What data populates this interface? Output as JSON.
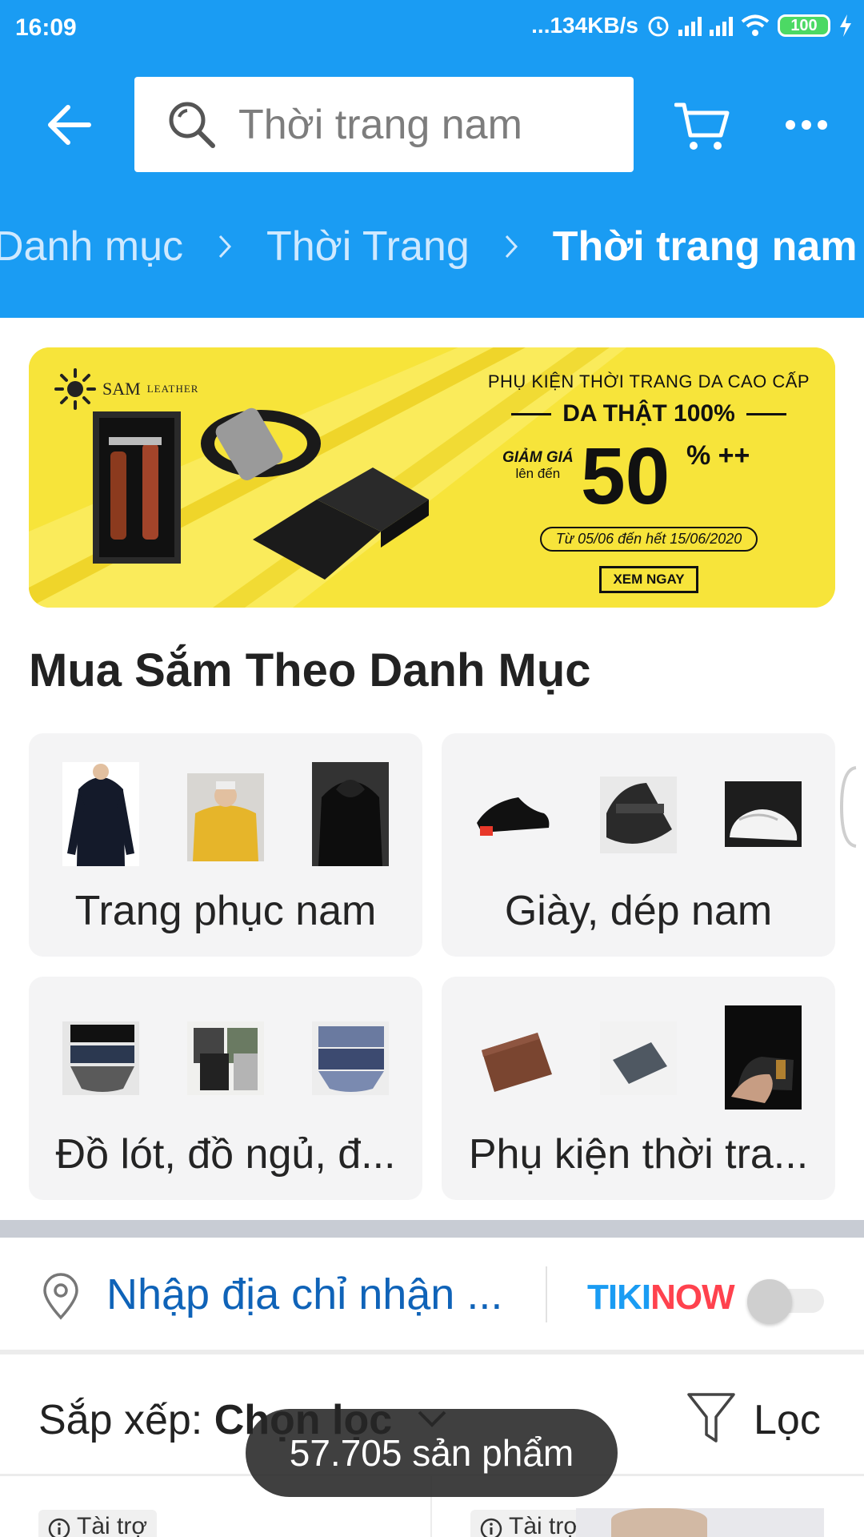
{
  "status_bar": {
    "time": "16:09",
    "network_speed": "...134KB/s",
    "battery": "100",
    "icons": [
      "alarm-icon",
      "signal-icon",
      "signal-icon",
      "wifi-icon",
      "battery-icon",
      "charging-icon"
    ]
  },
  "header": {
    "search_placeholder": "Thời trang nam",
    "icons": [
      "back-arrow-icon",
      "search-icon",
      "cart-icon",
      "more-icon"
    ]
  },
  "breadcrumb": {
    "items": [
      "Danh mục",
      "Thời Trang",
      "Thời trang nam"
    ]
  },
  "banner": {
    "brand": "SAM",
    "brand_sub": "LEATHER",
    "line1": "PHỤ KIỆN THỜI TRANG DA CAO CẤP",
    "line2": "DA THẬT 100%",
    "discount_label": "GIẢM GIÁ",
    "discount_sub": "lên đến",
    "discount_value": "50",
    "discount_suffix": "% ++",
    "date_range": "Từ 05/06 đến hết 15/06/2020",
    "cta": "XEM NGAY"
  },
  "categories": {
    "title": "Mua Sắm Theo Danh Mục",
    "items": [
      {
        "label": "Trang phục nam"
      },
      {
        "label": "Giày, dép nam"
      },
      {
        "label": "Đồ lót, đồ ngủ, đ..."
      },
      {
        "label": "Phụ kiện thời tra..."
      }
    ]
  },
  "address": {
    "placeholder": "Nhập địa chỉ nhận ...",
    "tikinow_a": "TIKI",
    "tikinow_b": "NOW",
    "tikinow_on": false
  },
  "sort": {
    "label": "Sắp xếp: ",
    "value": "Chọn lọc",
    "filter": "Lọc"
  },
  "products": {
    "badges": [
      "Tài trợ",
      "Tài trợ"
    ]
  },
  "toast": {
    "text": "57.705 sản phẩm"
  },
  "colors": {
    "brand_blue": "#1a9cf3",
    "link_blue": "#0f63b8",
    "tikinow_red": "#ff424e",
    "banner_yellow": "#f7e43a"
  }
}
